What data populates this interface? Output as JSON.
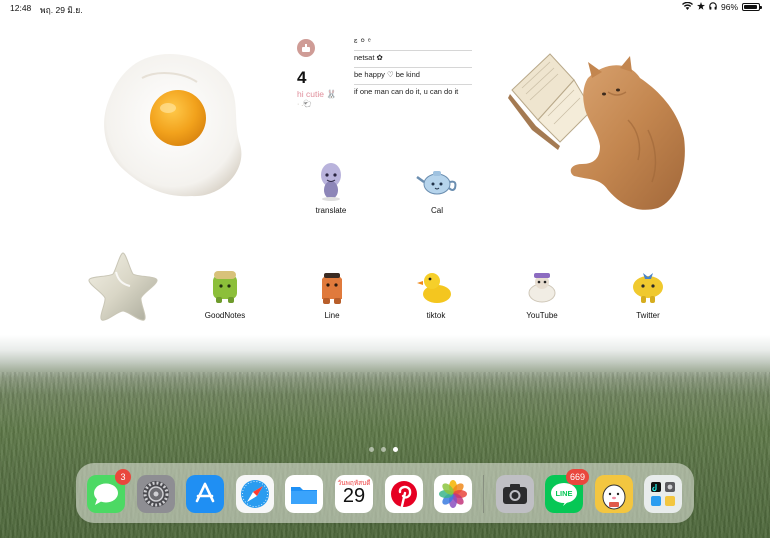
{
  "status_bar": {
    "time": "12:48",
    "date": "พฤ. 29 มิ.ย.",
    "battery": "96%",
    "battery_level": 0.96
  },
  "widget": {
    "day_number": "4",
    "caption": "hi cutie 🐰",
    "dots": "· .🐑",
    "lines": [
      "ɛ ⚪ ᵉ",
      "netsat ✿",
      "be happy ♡ be kind",
      "if one man can do it, u can do it"
    ]
  },
  "apps": {
    "translate": "translate",
    "cal": "Cal",
    "goodnotes": "GoodNotes",
    "line": "Line",
    "tiktok": "tiktok",
    "youtube": "YouTube",
    "twitter": "Twitter"
  },
  "dock": {
    "messages_badge": "3",
    "calendar_day_name": "วันพฤหัสบดี",
    "calendar_day_number": "29",
    "line_badge": "669",
    "line_label": "LINE"
  },
  "page_dots": {
    "count": 3,
    "active": 3
  },
  "colors": {
    "badge_red": "#e9473d",
    "messages_green": "#4cd964",
    "appstore_blue": "#1f8ff3",
    "pinterest_red": "#e60023",
    "line_green": "#06c755"
  }
}
